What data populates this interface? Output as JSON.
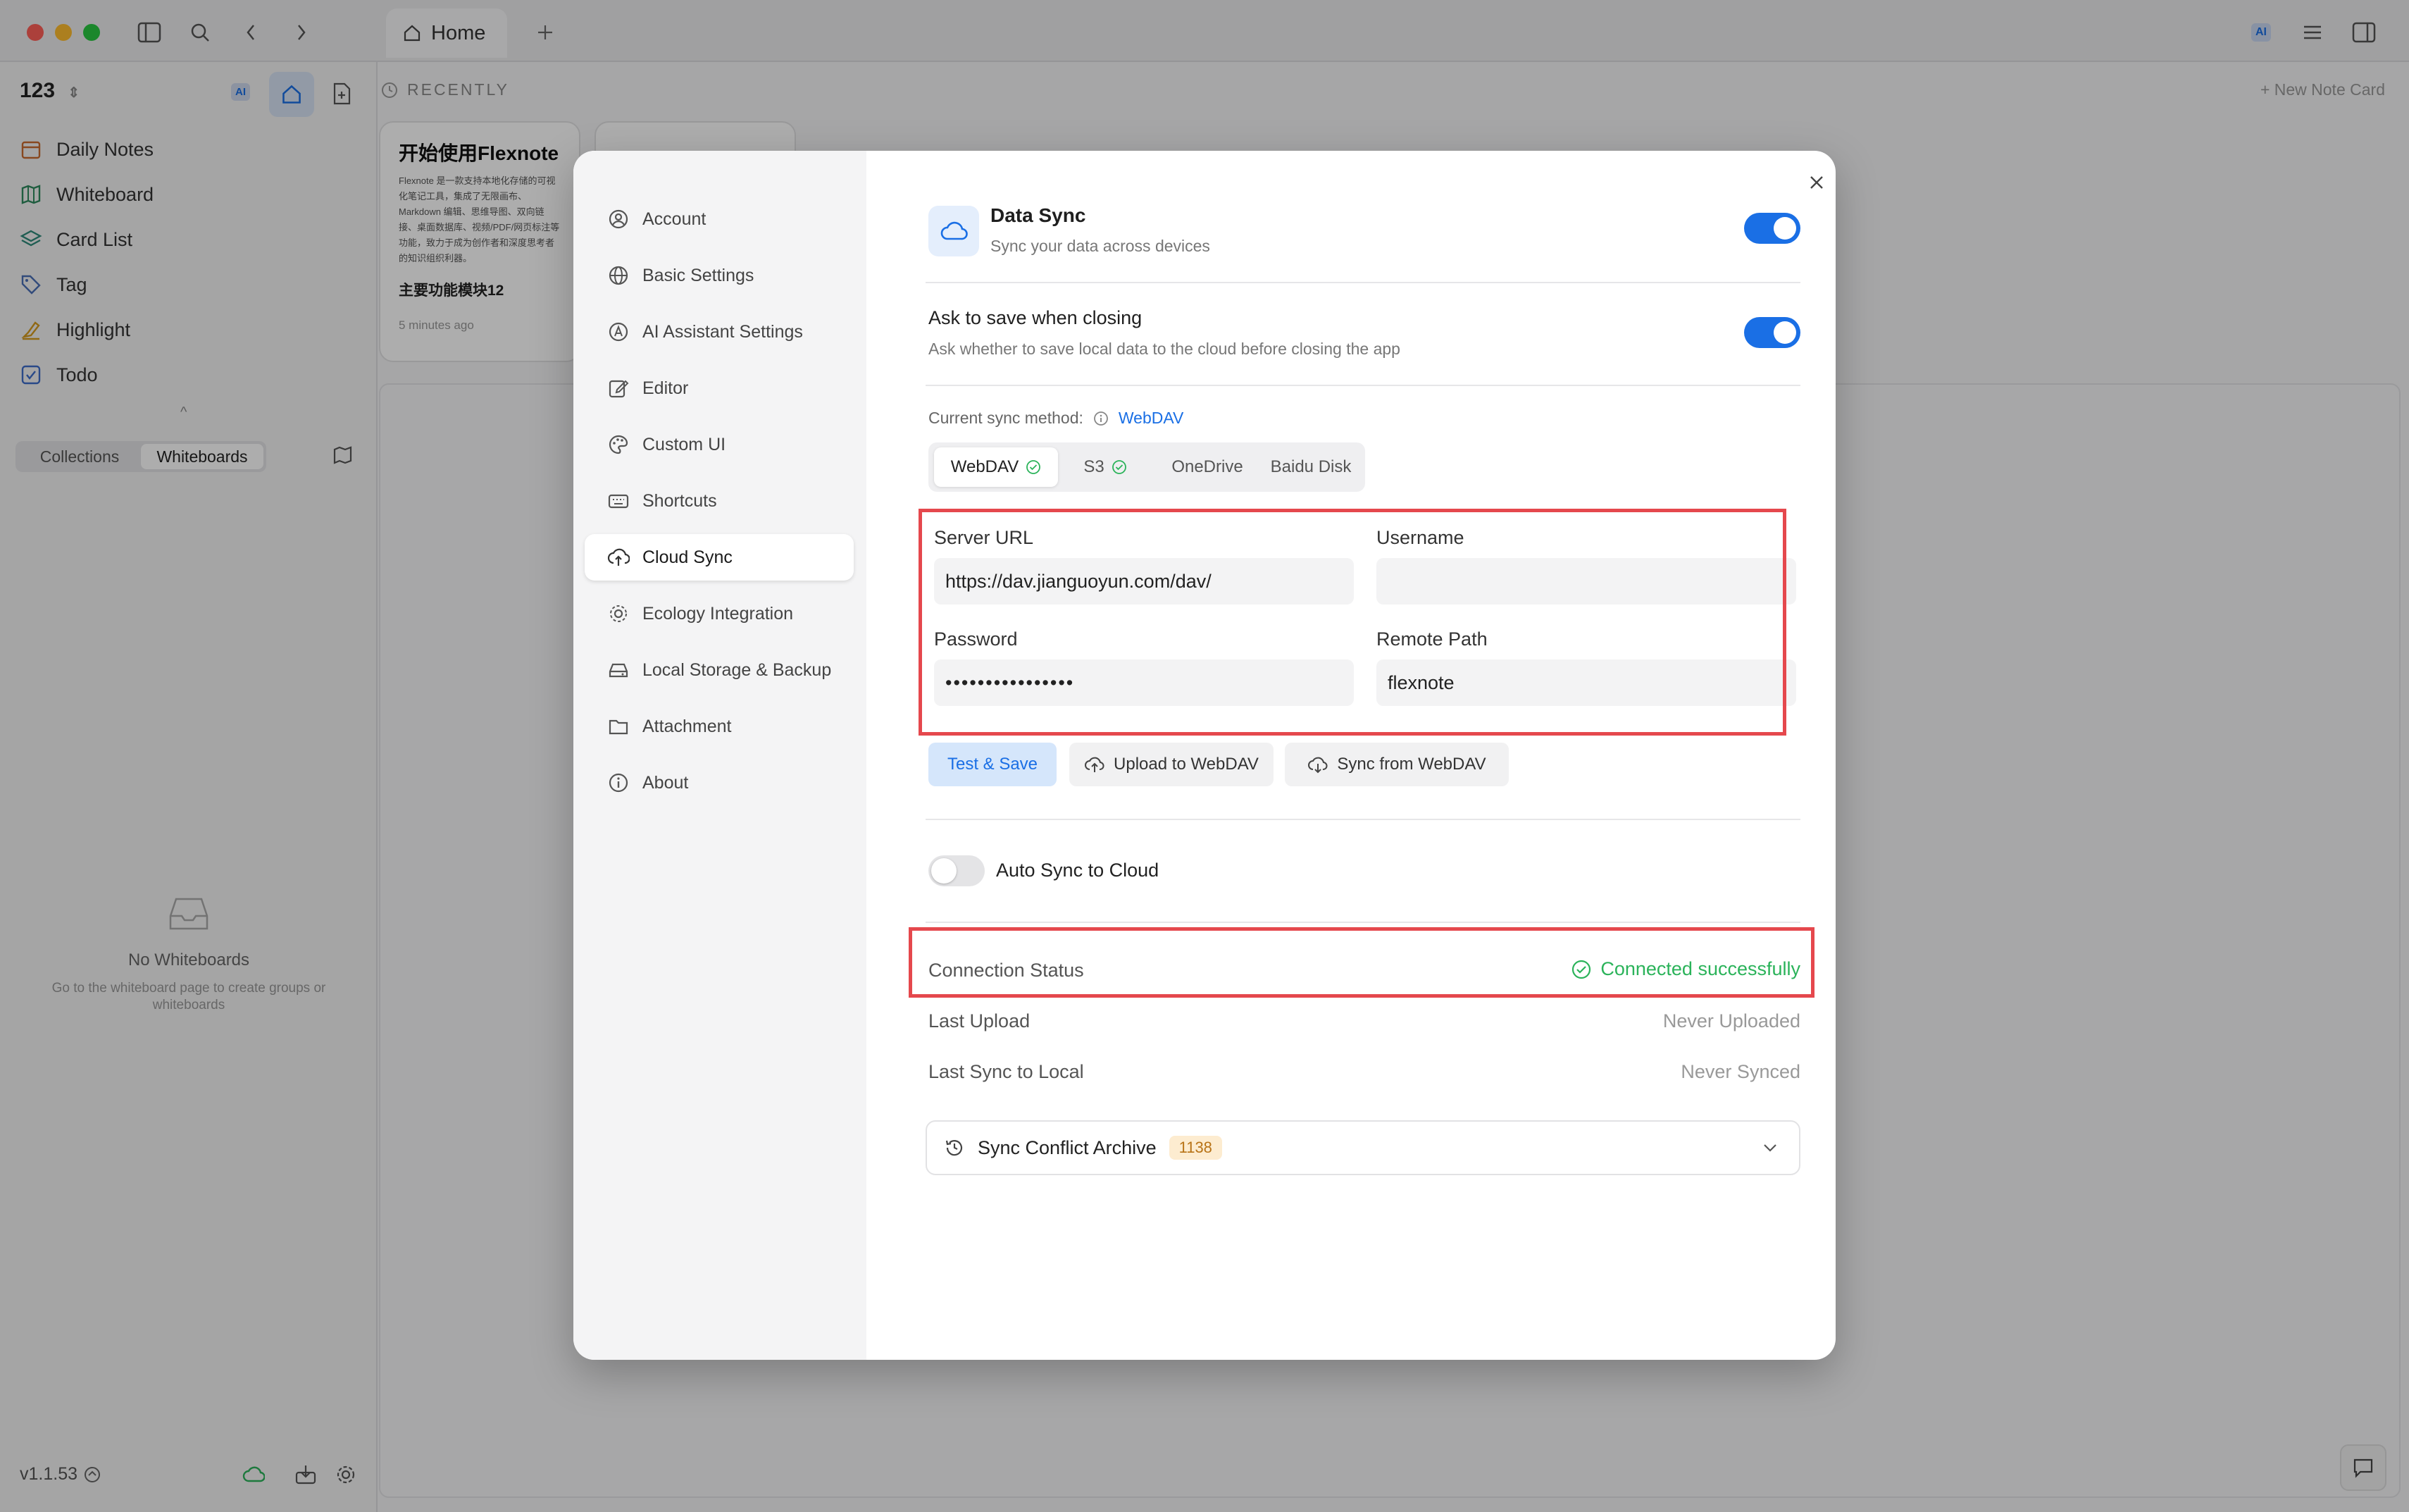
{
  "titlebar": {
    "tab_label": "Home"
  },
  "sidebar": {
    "workspace_name": "123",
    "ai_badge": "AI",
    "items": [
      {
        "label": "Daily Notes",
        "icon": "calendar-icon"
      },
      {
        "label": "Whiteboard",
        "icon": "map-icon"
      },
      {
        "label": "Card List",
        "icon": "layers-icon"
      },
      {
        "label": "Tag",
        "icon": "tag-icon"
      },
      {
        "label": "Highlight",
        "icon": "highlighter-icon"
      },
      {
        "label": "Todo",
        "icon": "checkbox-icon"
      }
    ],
    "tabs": [
      "Collections",
      "Whiteboards"
    ],
    "empty_title": "No Whiteboards",
    "empty_hint": "Go to the whiteboard page to create groups or whiteboards",
    "version": "v1.1.53"
  },
  "main": {
    "recently_label": "RECENTLY",
    "new_card_label": "+ New Note Card",
    "card": {
      "title": "开始使用Flexnote",
      "body": "Flexnote 是一款支持本地化存储的可视化笔记工具，集成了无限画布、Markdown 编辑、思维导图、双向链接、桌面数据库、视频/PDF/网页标注等功能，致力于成为创作者和深度思考者的知识组织利器。",
      "heading": "主要功能模块12",
      "time": "5 minutes ago"
    }
  },
  "settings": {
    "nav": [
      {
        "label": "Account",
        "icon": "user-circle-icon"
      },
      {
        "label": "Basic Settings",
        "icon": "globe-icon"
      },
      {
        "label": "AI Assistant Settings",
        "icon": "ai-icon"
      },
      {
        "label": "Editor",
        "icon": "edit-icon"
      },
      {
        "label": "Custom UI",
        "icon": "palette-icon"
      },
      {
        "label": "Shortcuts",
        "icon": "keyboard-icon"
      },
      {
        "label": "Cloud Sync",
        "icon": "cloud-upload-icon"
      },
      {
        "label": "Ecology Integration",
        "icon": "integration-icon"
      },
      {
        "label": "Local Storage & Backup",
        "icon": "drive-icon"
      },
      {
        "label": "Attachment",
        "icon": "folder-icon"
      },
      {
        "label": "About",
        "icon": "info-icon"
      }
    ],
    "active_nav": "Cloud Sync",
    "data_sync": {
      "title": "Data Sync",
      "subtitle": "Sync your data across devices",
      "enabled": true
    },
    "ask_save": {
      "title": "Ask to save when closing",
      "subtitle": "Ask whether to save local data to the cloud before closing the app",
      "enabled": true
    },
    "sync_method": {
      "label": "Current sync method:",
      "value": "WebDAV",
      "tabs": [
        "WebDAV",
        "S3",
        "OneDrive",
        "Baidu Disk"
      ]
    },
    "form": {
      "server_url_label": "Server URL",
      "server_url": "https://dav.jianguoyun.com/dav/",
      "username_label": "Username",
      "username": "",
      "password_label": "Password",
      "password": "••••••••••••••••",
      "remote_path_label": "Remote Path",
      "remote_path": "flexnote"
    },
    "buttons": {
      "test_save": "Test & Save",
      "upload": "Upload to WebDAV",
      "sync_from": "Sync from WebDAV"
    },
    "auto_sync": {
      "label": "Auto Sync to Cloud",
      "enabled": false
    },
    "status": {
      "connection_label": "Connection Status",
      "connection_value": "Connected successfully",
      "last_upload_label": "Last Upload",
      "last_upload_value": "Never Uploaded",
      "last_sync_label": "Last Sync to Local",
      "last_sync_value": "Never Synced"
    },
    "archive": {
      "label": "Sync Conflict Archive",
      "count": "1138"
    },
    "colors": {
      "accent": "#1a6fe5",
      "success": "#2bb35a",
      "highlight": "#e5484d"
    }
  }
}
